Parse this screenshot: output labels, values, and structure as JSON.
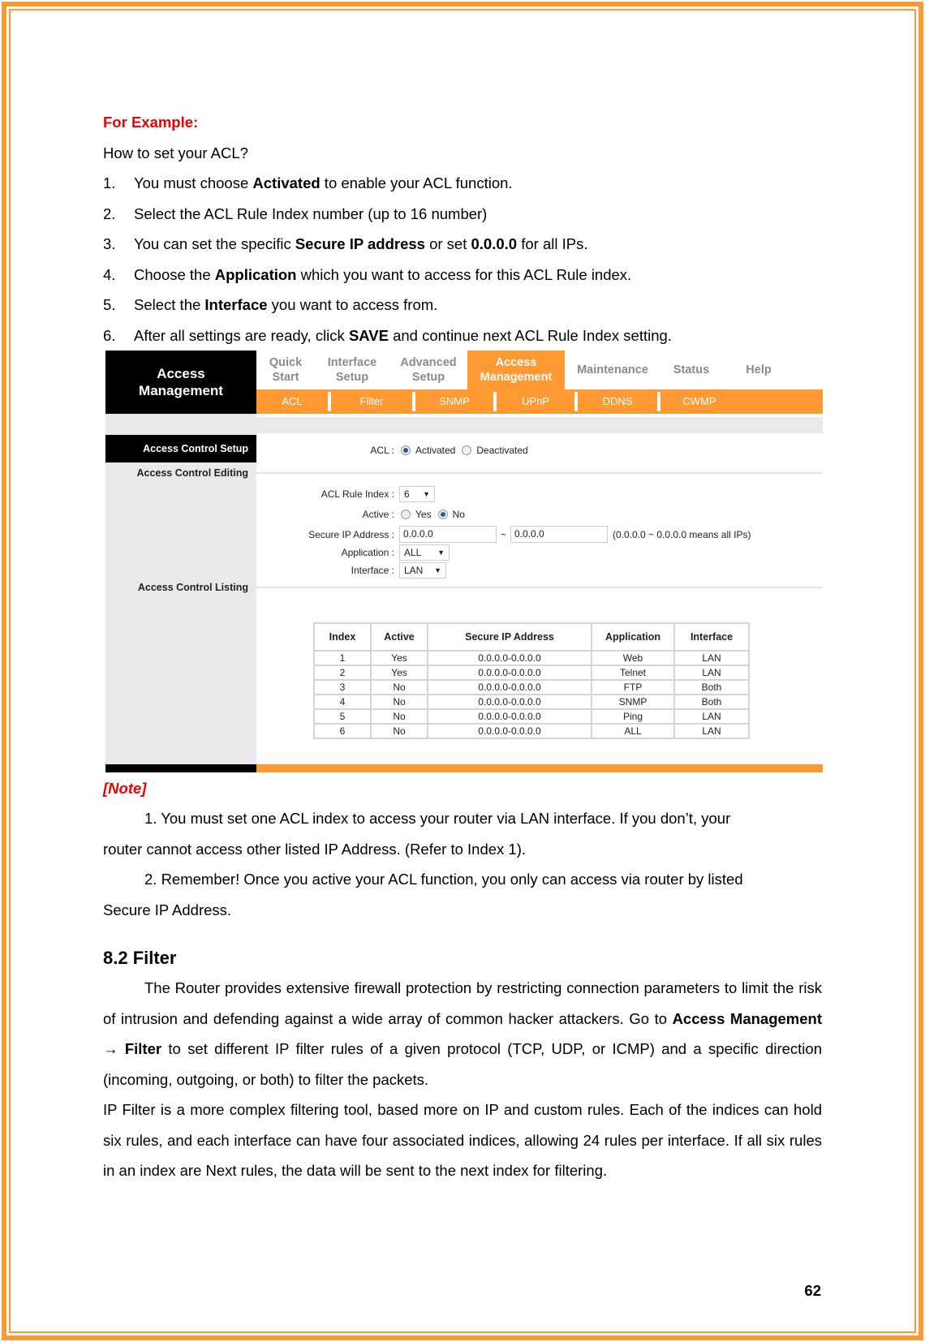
{
  "intro": {
    "heading": "For Example:",
    "question": "How to set your ACL?",
    "steps": [
      {
        "num": "1.",
        "pre": "You must choose ",
        "bold": "Activated",
        "post": " to enable your ACL function.",
        "bold2": "",
        "post2": ""
      },
      {
        "num": "2.",
        "pre": "Select the ACL Rule Index number (up to 16 number)",
        "bold": "",
        "post": "",
        "bold2": "",
        "post2": ""
      },
      {
        "num": "3.",
        "pre": "You can set the specific ",
        "bold": "Secure IP address",
        "post": " or set ",
        "bold2": "0.0.0.0",
        "post2": " for all IPs."
      },
      {
        "num": "4.",
        "pre": "Choose the ",
        "bold": "Application",
        "post": " which you want to access for this ACL Rule index.",
        "bold2": "",
        "post2": ""
      },
      {
        "num": "5.",
        "pre": "Select the ",
        "bold": "Interface",
        "post": " you want to access from.",
        "bold2": "",
        "post2": ""
      },
      {
        "num": "6.",
        "pre": "After all settings are ready, click ",
        "bold": "SAVE",
        "post": " and continue next ACL Rule Index setting.",
        "bold2": "",
        "post2": ""
      }
    ]
  },
  "router_ui": {
    "brand_line1": "Access",
    "brand_line2": "Management",
    "top_tabs": [
      {
        "line1": "Quick",
        "line2": "Start",
        "active": false
      },
      {
        "line1": "Interface",
        "line2": "Setup",
        "active": false
      },
      {
        "line1": "Advanced",
        "line2": "Setup",
        "active": false
      },
      {
        "line1": "Access",
        "line2": "Management",
        "active": true
      },
      {
        "line1": "Maintenance",
        "line2": "",
        "active": false
      },
      {
        "line1": "Status",
        "line2": "",
        "active": false
      },
      {
        "line1": "Help",
        "line2": "",
        "active": false
      }
    ],
    "sub_tabs": [
      "ACL",
      "Filter",
      "SNMP",
      "UPnP",
      "DDNS",
      "CWMP"
    ],
    "section_header": "Access Control Setup",
    "section_editing": "Access Control Editing",
    "section_listing": "Access Control Listing",
    "acl": {
      "label": "ACL :",
      "options": [
        "Activated",
        "Deactivated"
      ],
      "selected": "Activated"
    },
    "rule_index": {
      "label": "ACL Rule Index :",
      "value": "6"
    },
    "active": {
      "label": "Active :",
      "options": [
        "Yes",
        "No"
      ],
      "selected": "No"
    },
    "secure_ip": {
      "label": "Secure IP Address :",
      "start": "0.0.0.0",
      "separator": "~",
      "end": "0.0.0.0",
      "hint": "(0.0.0.0 ~ 0.0.0.0 means all IPs)"
    },
    "application": {
      "label": "Application :",
      "value": "ALL"
    },
    "interface": {
      "label": "Interface :",
      "value": "LAN"
    },
    "table": {
      "headers": [
        "Index",
        "Active",
        "Secure IP Address",
        "Application",
        "Interface"
      ],
      "rows": [
        [
          "1",
          "Yes",
          "0.0.0.0-0.0.0.0",
          "Web",
          "LAN"
        ],
        [
          "2",
          "Yes",
          "0.0.0.0-0.0.0.0",
          "Telnet",
          "LAN"
        ],
        [
          "3",
          "No",
          "0.0.0.0-0.0.0.0",
          "FTP",
          "Both"
        ],
        [
          "4",
          "No",
          "0.0.0.0-0.0.0.0",
          "SNMP",
          "Both"
        ],
        [
          "5",
          "No",
          "0.0.0.0-0.0.0.0",
          "Ping",
          "LAN"
        ],
        [
          "6",
          "No",
          "0.0.0.0-0.0.0.0",
          "ALL",
          "LAN"
        ]
      ]
    },
    "colors": {
      "accent": "#FF9933",
      "dark": "#000000",
      "panel": "#E9E9E9"
    }
  },
  "note": {
    "title": "[Note]",
    "item1_a": "1. You must set one ACL index to access your router via LAN interface. If you don’t, your",
    "item1_b": "router cannot access other listed IP Address. (Refer to Index 1).",
    "item2_a": "2. Remember! Once you active your ACL function, you only can access via router by listed",
    "item2_b": "Secure IP Address."
  },
  "filter_section": {
    "heading": "8.2 Filter",
    "para1_pre": "The Router provides extensive firewall protection by restricting connection parameters to limit the risk of intrusion and defending against a wide array of common hacker attackers. Go to ",
    "para1_bold": "Access Management → Filter",
    "para1_post": " to set different IP filter rules of a given protocol (TCP, UDP, or ICMP) and a specific direction (incoming, outgoing, or both) to filter the packets.",
    "para2": "IP Filter is a more complex filtering tool, based more on IP and custom rules. Each of the indices can hold six rules, and each interface can have four associated indices, allowing 24 rules per interface. If all six rules in an index are Next rules, the data will be sent to the next index for filtering."
  },
  "page_number": "62",
  "colors": {
    "border": "#FF9933",
    "heading_red": "#EE0000"
  }
}
